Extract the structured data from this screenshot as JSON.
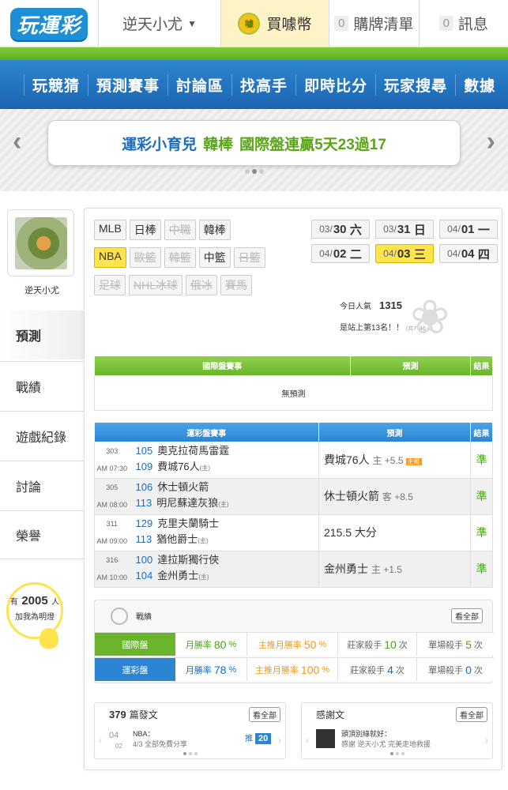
{
  "header": {
    "logo": "玩運彩",
    "user": "逆天小尤",
    "buy_label": "買噱幣",
    "coin_icon": "噱",
    "cart_count": "0",
    "cart_label": "購牌清單",
    "msg_count": "0",
    "msg_label": "訊息"
  },
  "nav": [
    "玩競猜",
    "預測賽事",
    "討論區",
    "找高手",
    "即時比分",
    "玩家搜尋",
    "數據"
  ],
  "banner": {
    "a": "運彩小育兒",
    "b": "韓棒",
    "c": "國際盤連贏5天23過17"
  },
  "sidebar": {
    "name": "逆天小尤",
    "items": [
      "預測",
      "戰績",
      "遊戲紀錄",
      "討論",
      "榮譽"
    ],
    "fans_prefix": "有",
    "fans_count": "2005",
    "fans_suffix": "人",
    "fans_cta": "加我為明燈"
  },
  "sports": {
    "row1": [
      "MLB",
      "日棒",
      "中職",
      "韓棒"
    ],
    "row2": [
      "NBA",
      "歐籃",
      "韓籃",
      "中籃",
      "日籃"
    ],
    "row3": [
      "足球",
      "NHL冰球",
      "俄冰",
      "賽馬"
    ]
  },
  "dates": [
    {
      "md": "03/",
      "d": "30",
      "w": "六"
    },
    {
      "md": "03/",
      "d": "31",
      "w": "日"
    },
    {
      "md": "04/",
      "d": "01",
      "w": "一"
    },
    {
      "md": "04/",
      "d": "02",
      "w": "二"
    },
    {
      "md": "04/",
      "d": "03",
      "w": "三"
    },
    {
      "md": "04/",
      "d": "04",
      "w": "四"
    }
  ],
  "popularity": {
    "label": "今日人氣",
    "value": "1315",
    "rank": "是站上第13名！！",
    "rank_sub": "(共7746人)"
  },
  "intl_table": {
    "h1": "國際盤賽事",
    "h2": "預測",
    "h3": "結果",
    "empty": "無預測"
  },
  "lottery_table": {
    "h1": "運彩盤賽事",
    "h2": "預測",
    "h3": "結果",
    "rows": [
      {
        "id": "303",
        "time": "AM 07:30",
        "n1": "105",
        "t1": "奧克拉荷馬雷霆",
        "n2": "109",
        "t2": "費城76人",
        "tag2": "(主)",
        "pred": "費城76人",
        "sub": "主 +5.5",
        "hot": "主推",
        "res": "準"
      },
      {
        "id": "305",
        "time": "AM 08:00",
        "n1": "106",
        "t1": "休士頓火箭",
        "n2": "113",
        "t2": "明尼蘇達灰狼",
        "tag2": "(主)",
        "pred": "休士頓火箭",
        "sub": "客 +8.5",
        "hot": "",
        "res": "準"
      },
      {
        "id": "311",
        "time": "AM 09:00",
        "n1": "129",
        "t1": "克里夫蘭騎士",
        "n2": "113",
        "t2": "猶他爵士",
        "tag2": "(主)",
        "pred": "215.5 大分",
        "sub": "",
        "hot": "",
        "res": "準"
      },
      {
        "id": "316",
        "time": "AM 10:00",
        "n1": "100",
        "t1": "達拉斯獨行俠",
        "n2": "104",
        "t2": "金州勇士",
        "tag2": "(主)",
        "pred": "金州勇士",
        "sub": "主 +1.5",
        "hot": "",
        "res": "準"
      }
    ]
  },
  "stats": {
    "title": "戰績",
    "view_all": "看全部",
    "intl": {
      "label": "國際盤",
      "month_pre": "月勝率",
      "month": "80",
      "pct": "%",
      "main_pre": "主推月勝率",
      "main": "50",
      "killer_pre": "莊家殺手",
      "killer": "10",
      "unit": "次",
      "single_pre": "單場殺手",
      "single": "5"
    },
    "lottery": {
      "label": "運彩盤",
      "month_pre": "月勝率",
      "month": "78",
      "pct": "%",
      "main_pre": "主推月勝率",
      "main": "100",
      "killer_pre": "莊家殺手",
      "killer": "4",
      "unit": "次",
      "single_pre": "單場殺手",
      "single": "0"
    }
  },
  "posts": {
    "count": "379",
    "label": "篇發文",
    "view_all": "看全部",
    "date_m": "04",
    "date_d": "02",
    "title": "NBA：",
    "text": "4/3 全部免費分享",
    "push_label": "推",
    "push": "20"
  },
  "thanks": {
    "label": "感謝文",
    "view_all": "看全部",
    "title": "頭頂別綠就好：",
    "text": "感謝 逆天小尤 完美走地救援"
  }
}
